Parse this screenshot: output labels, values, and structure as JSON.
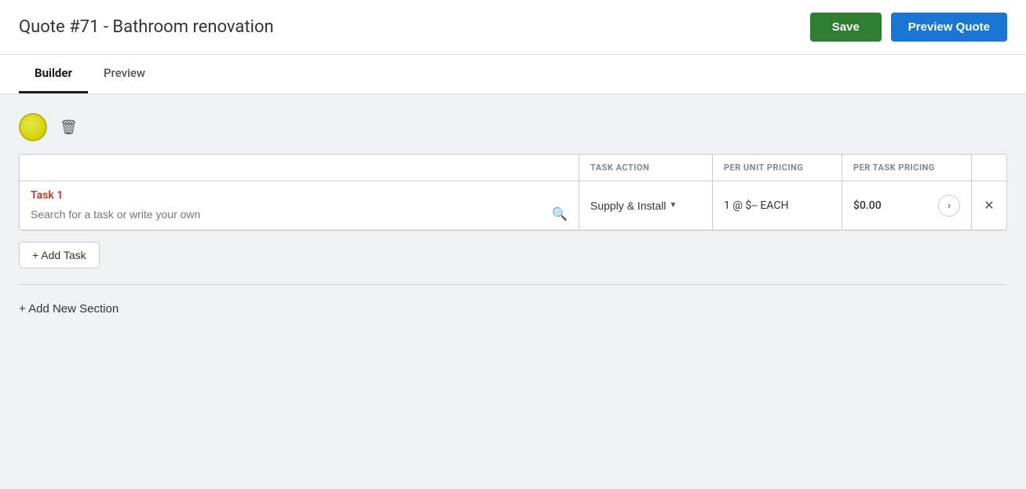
{
  "header": {
    "quote_label": "Quote #71",
    "quote_dash": "  - ",
    "quote_name": "Bathroom renovation",
    "save_button": "Save",
    "preview_button": "Preview Quote"
  },
  "tabs": [
    {
      "id": "builder",
      "label": "Builder",
      "active": true
    },
    {
      "id": "preview",
      "label": "Preview",
      "active": false
    }
  ],
  "section": {
    "color": "#d4d400",
    "delete_icon": "🗑"
  },
  "task_table": {
    "columns": [
      {
        "id": "task",
        "label": ""
      },
      {
        "id": "task_action",
        "label": "TASK ACTION"
      },
      {
        "id": "per_unit",
        "label": "PER UNIT PRICING"
      },
      {
        "id": "per_task",
        "label": "PER TASK PRICING"
      },
      {
        "id": "close",
        "label": ""
      }
    ],
    "rows": [
      {
        "task_number": "Task 1",
        "search_placeholder": "Search for a task or write your own",
        "task_action": "Supply & Install",
        "per_unit": "1 @ $-- EACH",
        "per_task_price": "$0.00"
      }
    ]
  },
  "add_task_button": "+ Add Task",
  "add_section_button": "+ Add New Section"
}
